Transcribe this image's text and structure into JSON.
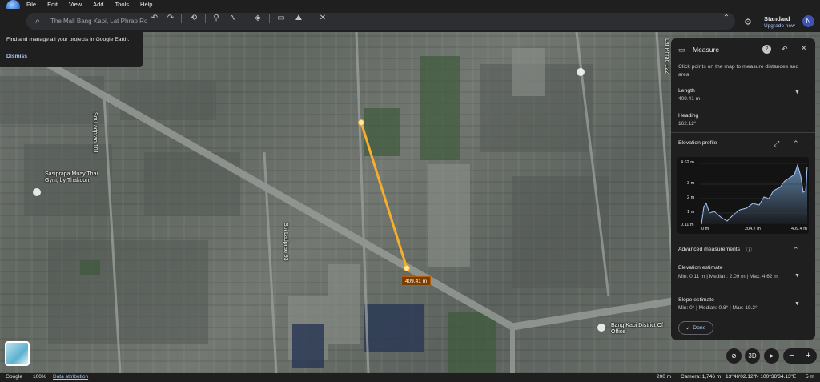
{
  "menu": [
    "File",
    "Edit",
    "View",
    "Add",
    "Tools",
    "Help"
  ],
  "search": {
    "placeholder": "The Mall Bang Kapi, Lat Phrao Ro"
  },
  "account": {
    "plan": "Standard",
    "upgrade": "Upgrade now",
    "avatar_letter": "N"
  },
  "tooltip": {
    "text": "Find and manage all your projects in Google Earth.",
    "dismiss": "Dismiss"
  },
  "measure": {
    "title": "Measure",
    "description": "Click points on the map to measure distances and area",
    "length_label": "Length",
    "length_value": "409.41 m",
    "heading_label": "Heading",
    "heading_value": "162.12°",
    "elevation_profile_label": "Elevation profile",
    "advanced_label": "Advanced measurements",
    "elevation_estimate_label": "Elevation estimate",
    "elevation_estimate_value": "Min: 0.11 m | Median: 2.09 m | Max: 4.62 m",
    "slope_estimate_label": "Slope estimate",
    "slope_estimate_value": "Min: 0° | Median: 0.8° | Max: 19.2°",
    "done_label": "Done"
  },
  "elevation_chart": {
    "y_ticks": [
      "4.62 m",
      "3 m",
      "2 m",
      "1 m",
      "0.11 m"
    ],
    "x_ticks": [
      "0 m",
      "204.7 m",
      "409.4 m"
    ]
  },
  "map": {
    "distance_label": "409.41 m",
    "places": [
      {
        "text": "Sasiprapa Muay Thai Gym, by Thakoon"
      },
      {
        "text": "Bang Kapi District Of Office"
      }
    ],
    "roads": [
      "Soi Ladprao 101",
      "Soi Ladprao 93",
      "Lat Phrao 122"
    ],
    "view3d": "3D"
  },
  "status": {
    "brand": "Google",
    "zoom": "100%",
    "attribution": "Data attribution",
    "scale": "200 m",
    "camera": "Camera: 1,746 m",
    "coords": "13°46'02.12\"N 100°38'34.13\"E",
    "elevation": "5 m"
  }
}
